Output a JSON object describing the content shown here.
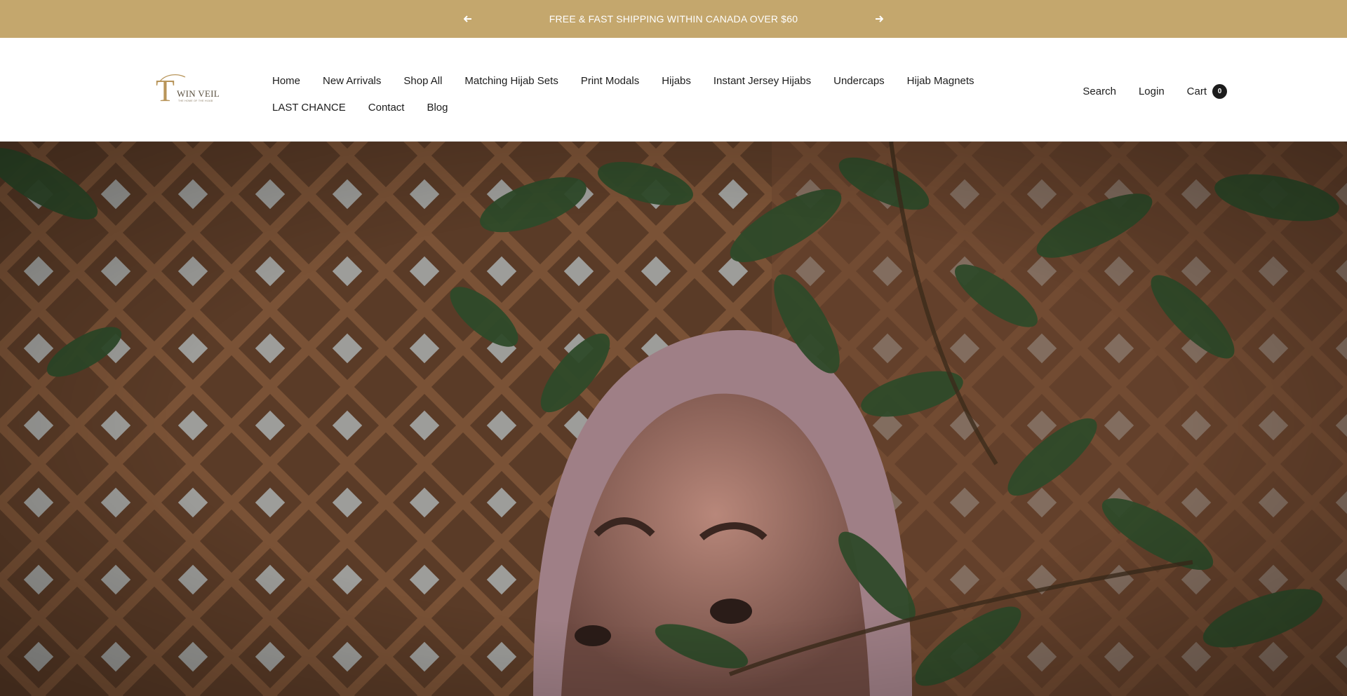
{
  "announcement": {
    "message": "FREE & FAST SHIPPING WITHIN CANADA OVER $60",
    "prev_icon": "arrow-left-icon",
    "next_icon": "arrow-right-icon"
  },
  "logo": {
    "letter": "T",
    "wordmark": "WIN VEIL",
    "tagline": "THE HOME OF THE HIJAB"
  },
  "nav": {
    "row1": [
      {
        "label": "Home"
      },
      {
        "label": "New Arrivals"
      },
      {
        "label": "Shop All"
      },
      {
        "label": "Matching Hijab Sets"
      },
      {
        "label": "Print Modals"
      },
      {
        "label": "Hijabs"
      },
      {
        "label": "Instant Jersey Hijabs"
      },
      {
        "label": "Undercaps"
      },
      {
        "label": "Hijab Magnets"
      }
    ],
    "row2": [
      {
        "label": "LAST CHANCE"
      },
      {
        "label": "Contact"
      },
      {
        "label": "Blog"
      }
    ]
  },
  "actions": {
    "search": "Search",
    "login": "Login",
    "cart": "Cart",
    "cart_count": "0"
  },
  "colors": {
    "announcement_bg": "#c4a76d",
    "logo_gold": "#b8955a",
    "text": "#1c1c1c"
  }
}
